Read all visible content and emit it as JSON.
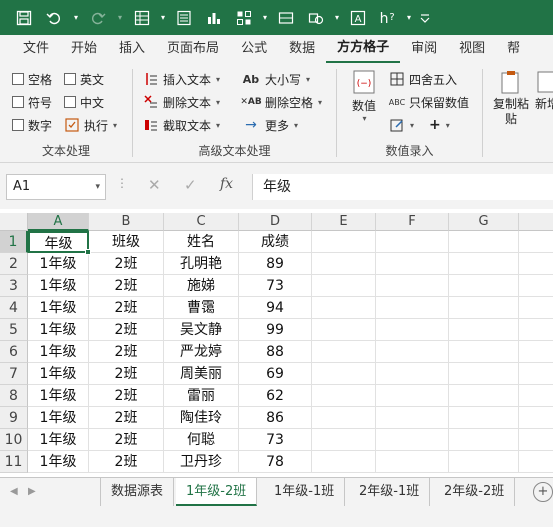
{
  "titlebar": {
    "icons": [
      "save-icon",
      "undo-icon",
      "redo-icon",
      "table-icon",
      "chart-icon",
      "document-icon",
      "shapes-icon",
      "text-icon",
      "help-icon",
      "more-icon"
    ]
  },
  "ribbon_tabs": [
    "文件",
    "开始",
    "插入",
    "页面布局",
    "公式",
    "数据",
    "方方格子",
    "审阅",
    "视图",
    "帮"
  ],
  "active_tab": "方方格子",
  "text_group": {
    "checkboxes": [
      {
        "label": "空格"
      },
      {
        "label": "英文"
      },
      {
        "label": "符号"
      },
      {
        "label": "中文"
      },
      {
        "label": "数字"
      }
    ],
    "execute_label": "执行",
    "group_label": "文本处理"
  },
  "adv_group": {
    "insert_text": "插入文本",
    "delete_text": "删除文本",
    "extract_text": "截取文本",
    "case_label": "大小写",
    "delete_spaces": "删除空格",
    "more_label": "更多",
    "group_label": "高级文本处理"
  },
  "numeric_group": {
    "value_label": "数值",
    "round_label": "四舍五入",
    "keep_value": "只保留数值",
    "plus_label": "+",
    "group_label": "数值录入"
  },
  "paste_group": {
    "copy_paste": "复制粘贴",
    "new_label": "新增"
  },
  "formula_bar": {
    "name_box": "A1",
    "formula": "年级"
  },
  "columns": [
    "A",
    "B",
    "C",
    "D",
    "E",
    "F",
    "G"
  ],
  "rows": [
    "1",
    "2",
    "3",
    "4",
    "5",
    "6",
    "7",
    "8",
    "9",
    "10",
    "11"
  ],
  "cells": [
    [
      "年级",
      "班级",
      "姓名",
      "成绩"
    ],
    [
      "1年级",
      "2班",
      "孔明艳",
      "89"
    ],
    [
      "1年级",
      "2班",
      "施娣",
      "73"
    ],
    [
      "1年级",
      "2班",
      "曹霭",
      "94"
    ],
    [
      "1年级",
      "2班",
      "吴文静",
      "99"
    ],
    [
      "1年级",
      "2班",
      "严龙婷",
      "88"
    ],
    [
      "1年级",
      "2班",
      "周美丽",
      "69"
    ],
    [
      "1年级",
      "2班",
      "雷丽",
      "62"
    ],
    [
      "1年级",
      "2班",
      "陶佳玲",
      "86"
    ],
    [
      "1年级",
      "2班",
      "何聪",
      "73"
    ],
    [
      "1年级",
      "2班",
      "卫丹珍",
      "78"
    ]
  ],
  "sheet_tabs": [
    "数据源表",
    "1年级-2班",
    "1年级-1班",
    "2年级-1班",
    "2年级-2班"
  ],
  "active_sheet": "1年级-2班",
  "colors": {
    "accent": "#217346"
  }
}
